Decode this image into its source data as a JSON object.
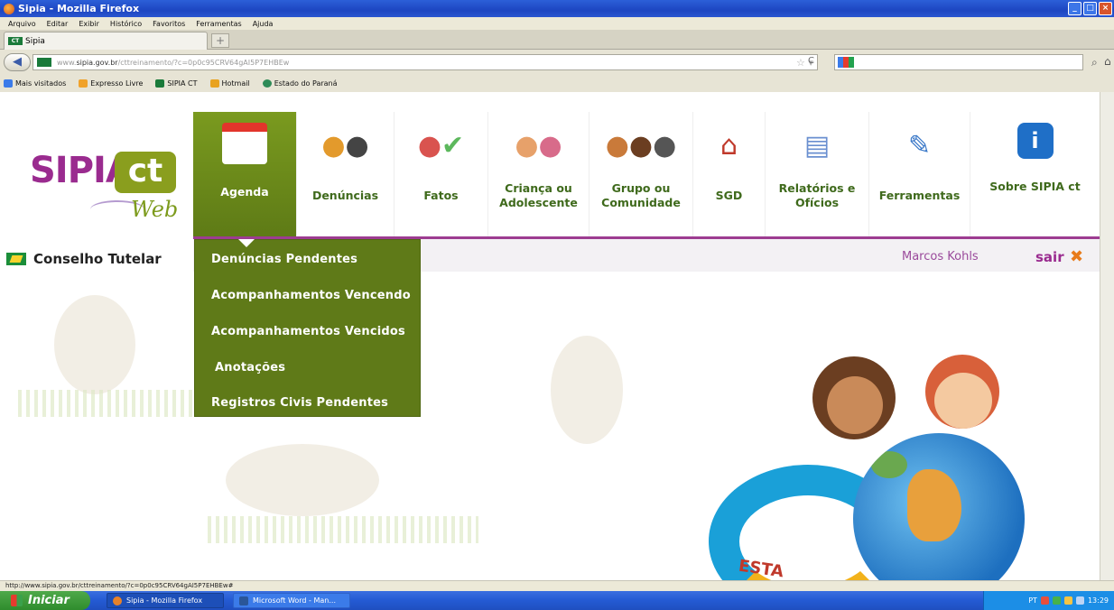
{
  "window": {
    "title": "Sipia - Mozilla Firefox",
    "controls": [
      "_",
      "□",
      "×"
    ]
  },
  "menubar": [
    "Arquivo",
    "Editar",
    "Exibir",
    "Histórico",
    "Favoritos",
    "Ferramentas",
    "Ajuda"
  ],
  "tab": {
    "label": "Sipia",
    "favicon": "CT"
  },
  "address": {
    "prefix": "www.",
    "host": "sipia.gov.br",
    "path": "/cttreinamento/?c=0p0c95CRV64gAI5P7EHBEw"
  },
  "bookmarks": [
    {
      "label": "Mais visitados",
      "color": "#3b7be9"
    },
    {
      "label": "Expresso Livre",
      "color": "#f0a22a"
    },
    {
      "label": "SIPIA CT",
      "color": "#1a7a3a"
    },
    {
      "label": "Hotmail",
      "color": "#e8a21f"
    },
    {
      "label": "Estado do Paraná",
      "color": "#2e8b57"
    }
  ],
  "logo": {
    "main": "SIPIA",
    "badge": "ct",
    "sub": "Web"
  },
  "conselho": "Conselho Tutelar",
  "nav": [
    {
      "label": "Agenda",
      "icon": "calendar-icon",
      "active": true
    },
    {
      "label": "Denúncias",
      "icon": "people-icon"
    },
    {
      "label": "Fatos",
      "icon": "users-check-icon"
    },
    {
      "label": "Criança ou Adolescente",
      "icon": "children-icon"
    },
    {
      "label": "Grupo ou Comunidade",
      "icon": "group-icon"
    },
    {
      "label": "SGD",
      "icon": "house-icon"
    },
    {
      "label": "Relatórios e Ofícios",
      "icon": "documents-icon"
    },
    {
      "label": "Ferramentas",
      "icon": "tools-icon"
    },
    {
      "label": "Sobre SIPIA ct",
      "icon": "info-icon"
    }
  ],
  "user": {
    "name": "Marcos Kohls",
    "logout": "sair"
  },
  "dropdown": [
    "Denúncias Pendentes",
    "Acompanhamentos Vencendo",
    "Acompanhamentos Vencidos",
    "Anotações",
    "Registros Civis Pendentes"
  ],
  "banner": "ESTA",
  "status_url": "http://www.sipia.gov.br/cttreinamento/?c=0p0c95CRV64gAI5P7EHBEw#",
  "taskbar": {
    "start": "Iniciar",
    "tasks": [
      "Sipia - Mozilla Firefox",
      "Microsoft Word - Man..."
    ],
    "tray_lang": "PT",
    "clock": "13:29"
  }
}
